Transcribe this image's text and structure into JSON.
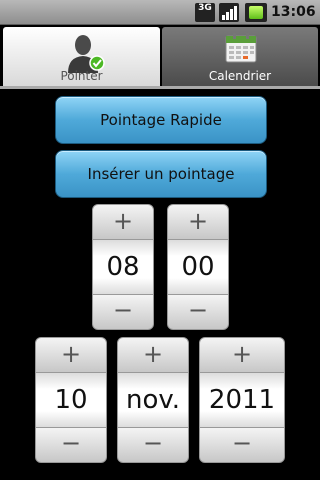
{
  "status_bar": {
    "network": "3G",
    "time": "13:06"
  },
  "tabs": [
    {
      "label": "Pointer",
      "icon": "person-check-icon",
      "selected": true
    },
    {
      "label": "Calendrier",
      "icon": "calendar-icon",
      "selected": false
    }
  ],
  "actions": {
    "quick_label": "Pointage Rapide",
    "insert_label": "Insérer un pointage"
  },
  "time_picker": {
    "hour": "08",
    "minute": "00"
  },
  "date_picker": {
    "day": "10",
    "month": "nov.",
    "year": "2011"
  },
  "picker_controls": {
    "increment": "+",
    "decrement": "−"
  },
  "colors": {
    "button_blue": "#4fa9d9",
    "background": "#000000"
  }
}
